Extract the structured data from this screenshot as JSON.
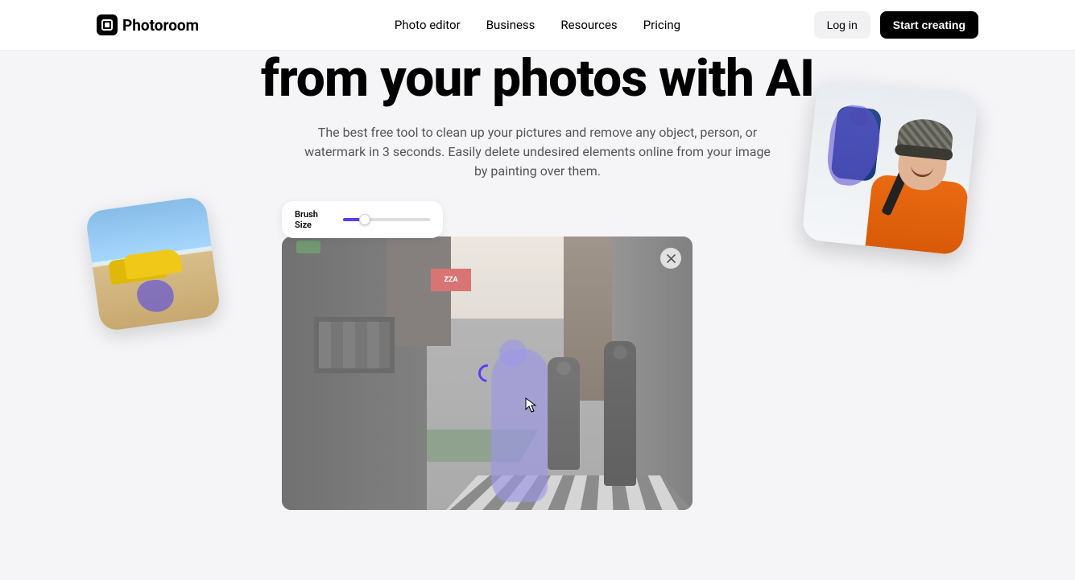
{
  "header": {
    "brand": "Photoroom",
    "nav": {
      "photo_editor": "Photo editor",
      "business": "Business",
      "resources": "Resources",
      "pricing": "Pricing"
    },
    "login": "Log in",
    "cta": "Start creating"
  },
  "hero": {
    "title": "from your photos with AI",
    "subtitle": "The best free tool to clean up your pictures and remove any object, person, or watermark in 3 seconds. Easily delete undesired elements online from your image by painting over them."
  },
  "editor": {
    "brush_label": "Brush Size",
    "brush_value_pct": 25,
    "close_tooltip": "Close",
    "pizza_sign": "ZZA"
  },
  "colors": {
    "accent_purple": "#5b3df5",
    "paint_purple": "rgba(99,87,214,0.65)",
    "cta_black": "#000000"
  }
}
